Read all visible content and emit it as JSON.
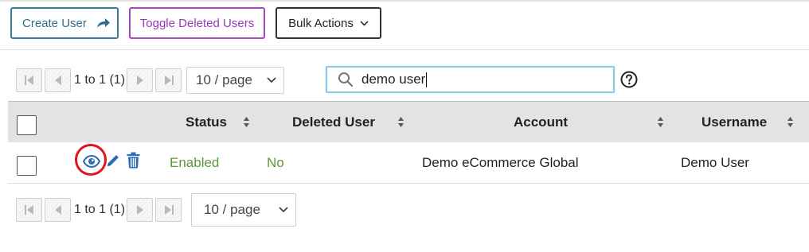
{
  "toolbar": {
    "create_user": "Create User",
    "toggle_deleted": "Toggle Deleted Users",
    "bulk_actions": "Bulk Actions"
  },
  "pager_top": {
    "range": "1 to 1 (1)",
    "per_page": "10 / page"
  },
  "pager_bottom": {
    "range": "1 to 1 (1)",
    "per_page": "10 / page"
  },
  "search": {
    "value": "demo user"
  },
  "table": {
    "columns": [
      "Status",
      "Deleted User",
      "Account",
      "Username"
    ],
    "rows": [
      {
        "status": "Enabled",
        "deleted": "No",
        "account": "Demo eCommerce Global",
        "username": "Demo User"
      }
    ]
  },
  "colors": {
    "create_border": "#3b7a99",
    "toggle_border": "#a347c0",
    "status_green": "#5a9a3a",
    "icon_blue": "#2a6fb5",
    "highlight_ring": "#e0151f"
  },
  "icons": [
    "share-arrow-icon",
    "chevron-down-icon",
    "first-page-icon",
    "prev-page-icon",
    "next-page-icon",
    "last-page-icon",
    "search-icon",
    "help-icon",
    "sort-icon",
    "view-eye-icon",
    "edit-pencil-icon",
    "delete-trash-icon"
  ]
}
